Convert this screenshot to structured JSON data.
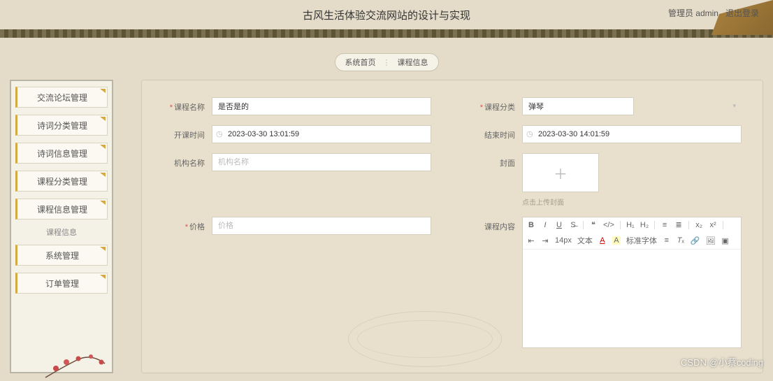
{
  "header": {
    "title": "古风生活体验交流网站的设计与实现",
    "admin_label": "管理员 admin",
    "logout_label": "退出登录"
  },
  "tabs": {
    "home": "系统首页",
    "current": "课程信息"
  },
  "sidebar": {
    "items": [
      "交流论坛管理",
      "诗词分类管理",
      "诗词信息管理",
      "课程分类管理",
      "课程信息管理"
    ],
    "sub_label": "课程信息",
    "items2": [
      "系统管理",
      "订单管理"
    ]
  },
  "form": {
    "course_name_label": "课程名称",
    "course_name_value": "是否是的",
    "course_category_label": "课程分类",
    "course_category_value": "弹琴",
    "start_time_label": "开课时间",
    "start_time_value": "2023-03-30 13:01:59",
    "end_time_label": "结束时间",
    "end_time_value": "2023-03-30 14:01:59",
    "org_name_label": "机构名称",
    "org_name_placeholder": "机构名称",
    "cover_label": "封面",
    "upload_hint": "点击上传封面",
    "price_label": "价格",
    "price_placeholder": "价格",
    "content_label": "课程内容"
  },
  "editor_toolbar": {
    "font_size": "14px",
    "text_btn": "文本",
    "font_family": "标准字体"
  },
  "watermark": "CSDN @小蔡coding"
}
